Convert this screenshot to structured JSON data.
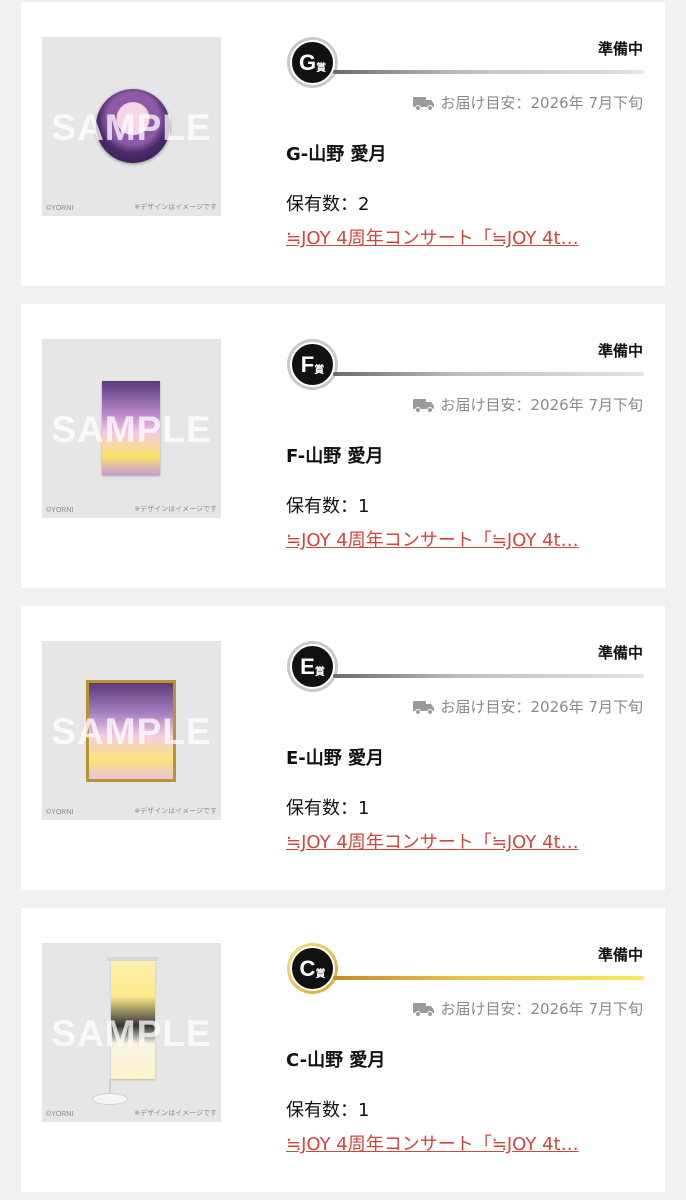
{
  "thumbnail": {
    "sample_watermark": "SAMPLE",
    "copyright": "©YORNI",
    "design_note": "※デザインはイメージです"
  },
  "items": [
    {
      "grade_letter": "G",
      "grade_suffix": "賞",
      "status": "準備中",
      "delivery": "お届け目安：2026年 7月下旬",
      "name": "G-山野 愛月",
      "quantity": "保有数：2",
      "event": "≒JOY 4周年コンサート「≒JOY 4t…",
      "art": "badge"
    },
    {
      "grade_letter": "F",
      "grade_suffix": "賞",
      "status": "準備中",
      "delivery": "お届け目安：2026年 7月下旬",
      "name": "F-山野 愛月",
      "quantity": "保有数：1",
      "event": "≒JOY 4周年コンサート「≒JOY 4t…",
      "art": "card"
    },
    {
      "grade_letter": "E",
      "grade_suffix": "賞",
      "status": "準備中",
      "delivery": "お届け目安：2026年 7月下旬",
      "name": "E-山野 愛月",
      "quantity": "保有数：1",
      "event": "≒JOY 4周年コンサート「≒JOY 4t…",
      "art": "frame"
    },
    {
      "grade_letter": "C",
      "grade_suffix": "賞",
      "status": "準備中",
      "delivery": "お届け目安：2026年 7月下旬",
      "name": "C-山野 愛月",
      "quantity": "保有数：1",
      "event": "≒JOY 4周年コンサート「≒JOY 4t…",
      "art": "banner"
    }
  ],
  "colors": {
    "link": "#d0463e",
    "status_text": "#111111",
    "muted": "#8a8a8a",
    "gold_accent": "#e8c04a"
  },
  "icons": {
    "delivery": "truck-icon"
  }
}
